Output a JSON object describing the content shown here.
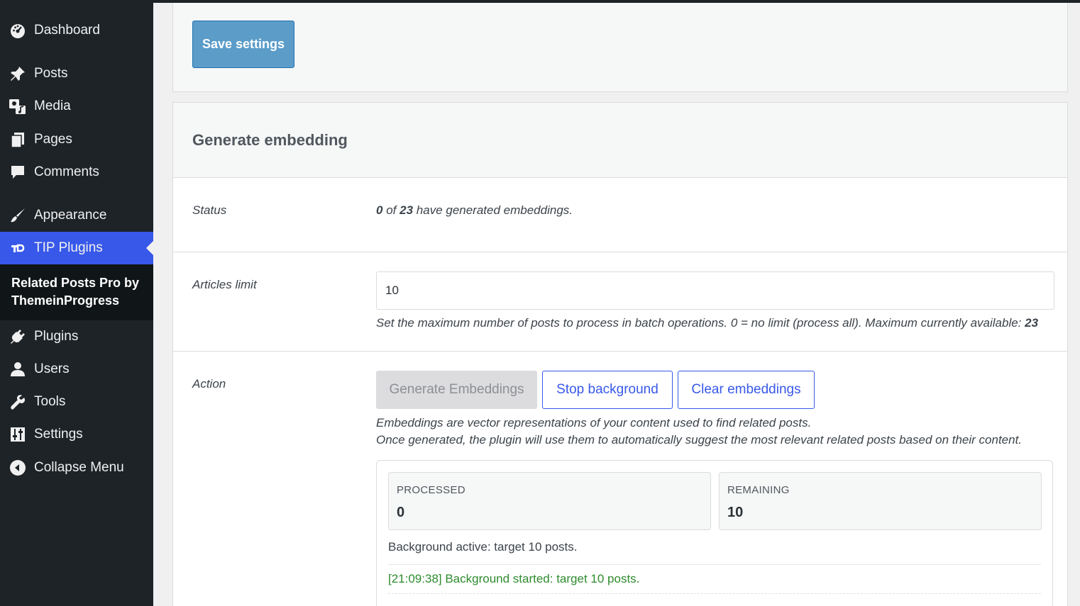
{
  "sidebar": {
    "items": [
      {
        "label": "Dashboard",
        "icon": "dashboard-icon"
      },
      {
        "label": "Posts",
        "icon": "pin-icon"
      },
      {
        "label": "Media",
        "icon": "media-icon"
      },
      {
        "label": "Pages",
        "icon": "pages-icon"
      },
      {
        "label": "Comments",
        "icon": "comment-icon"
      },
      {
        "label": "Appearance",
        "icon": "brush-icon"
      },
      {
        "label": "TIP Plugins",
        "icon": "tip-logo-icon"
      },
      {
        "label": "Plugins",
        "icon": "plug-icon"
      },
      {
        "label": "Users",
        "icon": "user-icon"
      },
      {
        "label": "Tools",
        "icon": "wrench-icon"
      },
      {
        "label": "Settings",
        "icon": "sliders-icon"
      },
      {
        "label": "Collapse Menu",
        "icon": "collapse-icon"
      }
    ],
    "submenu_item": "Related Posts Pro by ThemeinProgress",
    "active_color": "#3858e9"
  },
  "top_panel": {
    "save_label": "Save settings"
  },
  "section": {
    "title": "Generate embedding",
    "status": {
      "label": "Status",
      "done": "0",
      "of": "of",
      "total": "23",
      "suffix": "have generated embeddings."
    },
    "limit": {
      "label": "Articles limit",
      "value": "10",
      "description": "Set the maximum number of posts to process in batch operations. 0 = no limit (process all). Maximum currently available:",
      "max": "23"
    },
    "action": {
      "label": "Action",
      "generate_label": "Generate Embeddings",
      "stop_label": "Stop background",
      "clear_label": "Clear embeddings",
      "desc_line1": "Embeddings are vector representations of your content used to find related posts.",
      "desc_line2": "Once generated, the plugin will use them to automatically suggest the most relevant related posts based on their content."
    },
    "progress": {
      "processed_label": "PROCESSED",
      "processed_value": "0",
      "remaining_label": "REMAINING",
      "remaining_value": "10",
      "background_status": "Background active: target 10 posts.",
      "log_line": "[21:09:38] Background started: target 10 posts."
    }
  }
}
